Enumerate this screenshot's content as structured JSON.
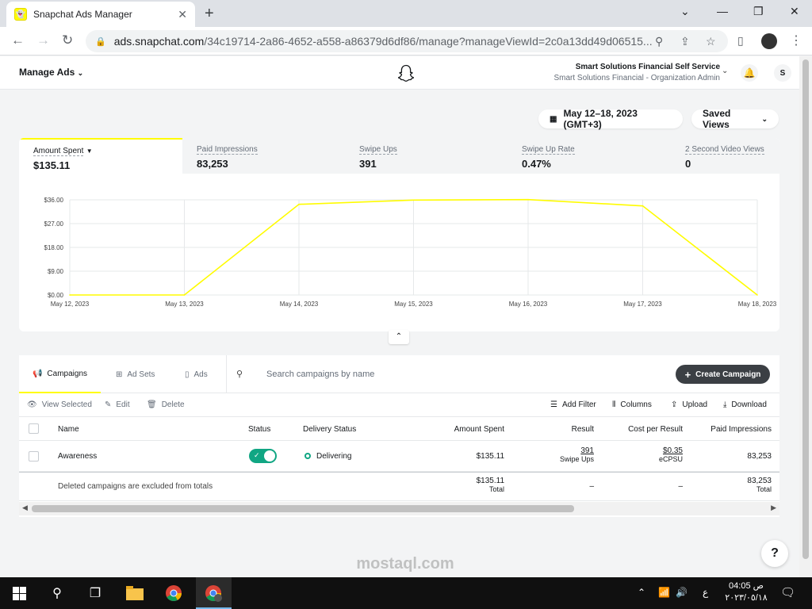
{
  "browser": {
    "tab_title": "Snapchat Ads Manager",
    "url_host": "ads.snapchat.com",
    "url_path": "/34c19714-2a86-4652-a558-a86379d6df86/manage?manageViewId=2c0a13dd49d06515..."
  },
  "header": {
    "menu_label": "Manage Ads",
    "org_name": "Smart Solutions Financial Self Service",
    "org_role": "Smart Solutions Financial - Organization Admin",
    "user_initial": "S"
  },
  "controls": {
    "date_range": "May 12–18, 2023 (GMT+3)",
    "saved_views": "Saved Views"
  },
  "metrics": [
    {
      "label": "Amount Spent",
      "value": "$135.11"
    },
    {
      "label": "Paid Impressions",
      "value": "83,253"
    },
    {
      "label": "Swipe Ups",
      "value": "391"
    },
    {
      "label": "Swipe Up Rate",
      "value": "0.47%"
    },
    {
      "label": "2 Second Video Views",
      "value": "0"
    }
  ],
  "chart_data": {
    "type": "line",
    "x": [
      "May 12, 2023",
      "May 13, 2023",
      "May 14, 2023",
      "May 15, 2023",
      "May 16, 2023",
      "May 17, 2023",
      "May 18, 2023"
    ],
    "series": [
      {
        "values": [
          0,
          0,
          34.3,
          35.9,
          36.1,
          33.7,
          0
        ]
      }
    ],
    "yticks": [
      "$0.00",
      "$9.00",
      "$18.00",
      "$27.00",
      "$36.00"
    ],
    "ylim": [
      0,
      36
    ],
    "grid": true,
    "color": "#fffc00"
  },
  "table_tabs": [
    {
      "label": "Campaigns",
      "icon": "megaphone-icon"
    },
    {
      "label": "Ad Sets",
      "icon": "grid-icon"
    },
    {
      "label": "Ads",
      "icon": "phone-icon"
    }
  ],
  "search": {
    "placeholder": "Search campaigns by name"
  },
  "create_label": "Create Campaign",
  "actions": {
    "view_selected": "View Selected",
    "edit": "Edit",
    "delete": "Delete",
    "add_filter": "Add Filter",
    "columns": "Columns",
    "upload": "Upload",
    "download": "Download"
  },
  "columns": [
    "Name",
    "Status",
    "Delivery Status",
    "Amount Spent",
    "Result",
    "Cost per Result",
    "Paid Impressions"
  ],
  "rows": [
    {
      "name": "Awareness",
      "delivery": "Delivering",
      "amount": "$135.11",
      "result": "391",
      "result_sub": "Swipe Ups",
      "cpr": "$0.35",
      "cpr_sub": "eCPSU",
      "impressions": "83,253"
    }
  ],
  "totals": {
    "note": "Deleted campaigns are excluded from totals",
    "amount": "$135.11",
    "amount_sub": "Total",
    "result": "–",
    "cpr": "–",
    "impressions": "83,253",
    "impressions_sub": "Total"
  },
  "watermark": "mostaql.com",
  "taskbar": {
    "time": "04:05 ص",
    "date": "٢٠٢٣/٠٥/١٨",
    "lang": "ع"
  }
}
